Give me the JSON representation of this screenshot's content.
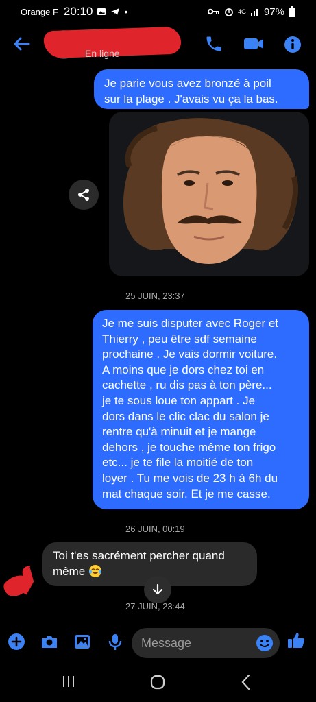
{
  "status_bar": {
    "carrier": "Orange F",
    "time": "20:10",
    "battery": "97%",
    "network": "4G"
  },
  "header": {
    "contact_status": "En ligne"
  },
  "messages": [
    {
      "side": "outgoing",
      "lines": [
        "Je parie vous avez bronzé  à poil",
        "sur la plage .  J'avais vu ça la bas."
      ]
    },
    {
      "side": "outgoing",
      "type": "photo"
    },
    {
      "side": "outgoing",
      "lines": [
        "Je me suis disputer avec Roger et",
        "Thierry ,  peu être sdf semaine",
        "prochaine . Je vais dormir voiture.",
        "A moins que je dors chez toi en",
        "cachette , ru dis pas à ton père...",
        "je te sous loue ton appart . Je",
        "dors dans le clic clac du salon je",
        "rentre qu'à minuit et je mange",
        "dehors , je touche même ton frigo",
        "etc...  je te file la moitié  de ton",
        "loyer . Tu me vois de 23 h à 6h du",
        "mat chaque soir. Et je me casse."
      ]
    },
    {
      "side": "incoming",
      "lines": [
        "Toi t'es sacrément percher quand",
        "même"
      ],
      "emoji": "tears-of-joy"
    }
  ],
  "timestamps": [
    "25 JUIN, 23:37",
    "26 JUIN, 00:19",
    "27 JUIN, 23:44"
  ],
  "composer": {
    "placeholder": "Message"
  },
  "icons": {
    "accent": "#3b82f6",
    "outgoing_bubble": "#2e6bff",
    "incoming_bubble": "#2a2a2a",
    "redaction": "#e0242b"
  }
}
